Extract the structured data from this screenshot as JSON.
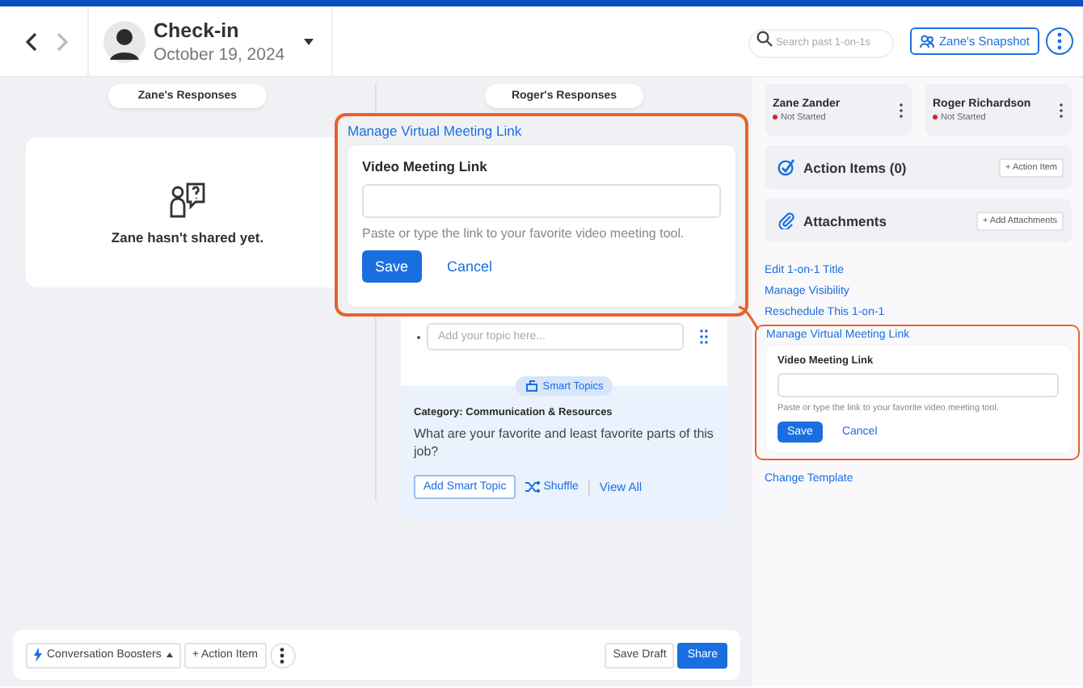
{
  "header": {
    "title": "Check-in",
    "date": "October 19, 2024",
    "search_placeholder": "Search past 1-on-1s",
    "snapshot_button": "Zane's Snapshot"
  },
  "zane_column": {
    "label": "Zane's Responses",
    "empty_message": "Zane hasn't shared yet."
  },
  "roger_column": {
    "label": "Roger's Responses",
    "topic_placeholder": "Add your topic here...",
    "smart_topics": {
      "badge": "Smart Topics",
      "category": "Category: Communication & Resources",
      "question": "What are your favorite and least favorite parts of this job?",
      "add_button": "Add Smart Topic",
      "shuffle_button": "Shuffle",
      "view_all_link": "View All"
    }
  },
  "callout": {
    "link": "Manage Virtual Meeting Link",
    "field_label": "Video Meeting Link",
    "hint": "Paste or type the link to your favorite video meeting tool.",
    "save": "Save",
    "cancel": "Cancel"
  },
  "sidebar": {
    "participants": [
      {
        "name": "Zane Zander",
        "status": "Not Started",
        "color": "#e0202a"
      },
      {
        "name": "Roger Richardson",
        "status": "Not Started",
        "color": "#e0202a"
      }
    ],
    "action_items": {
      "title": "Action Items (0)",
      "button": "+ Action Item"
    },
    "attachments": {
      "title": "Attachments",
      "button": "+ Add Attachments"
    },
    "links": [
      "Edit 1-on-1 Title",
      "Manage Visibility",
      "Reschedule This 1-on-1"
    ],
    "virtual_meeting": {
      "link": "Manage Virtual Meeting Link",
      "field_label": "Video Meeting Link",
      "hint": "Paste or type the link to your favorite video meeting tool.",
      "save": "Save",
      "cancel": "Cancel"
    },
    "change_template": "Change Template"
  },
  "footer": {
    "boosters": "Conversation Boosters",
    "action_item": "+ Action Item",
    "save_draft": "Save Draft",
    "share": "Share"
  }
}
